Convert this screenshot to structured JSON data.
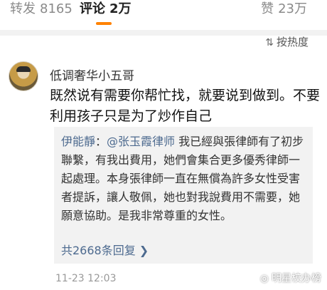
{
  "tabs": {
    "repost": {
      "label": "转发",
      "count": "8165"
    },
    "comment": {
      "label": "评论",
      "count": "2万"
    },
    "like": {
      "label": "赞",
      "count": "23万"
    }
  },
  "sort": {
    "label": "按热度",
    "icon": "sort-icon"
  },
  "comment": {
    "username": "低调奢华小五哥",
    "text": "既然说有需要你帮忙找，就要说到做到。不要利用孩子只是为了炒作自己",
    "quote": {
      "author": "伊能靜",
      "mention": "@张玉霞律师",
      "text": " 我已經與張律師有了初步聯繫，有我出費用，她們會集合更多優秀律師一起處理。本身張律師一直在無償為許多女性受害者提訴，讓人敬佩，她也對我說費用不需要，她願意協助。是我非常尊重的女性。",
      "replies": "共2668条回复 ❯"
    },
    "time": "11-23 12:03"
  },
  "watermark": {
    "text": "明星校办榜"
  }
}
